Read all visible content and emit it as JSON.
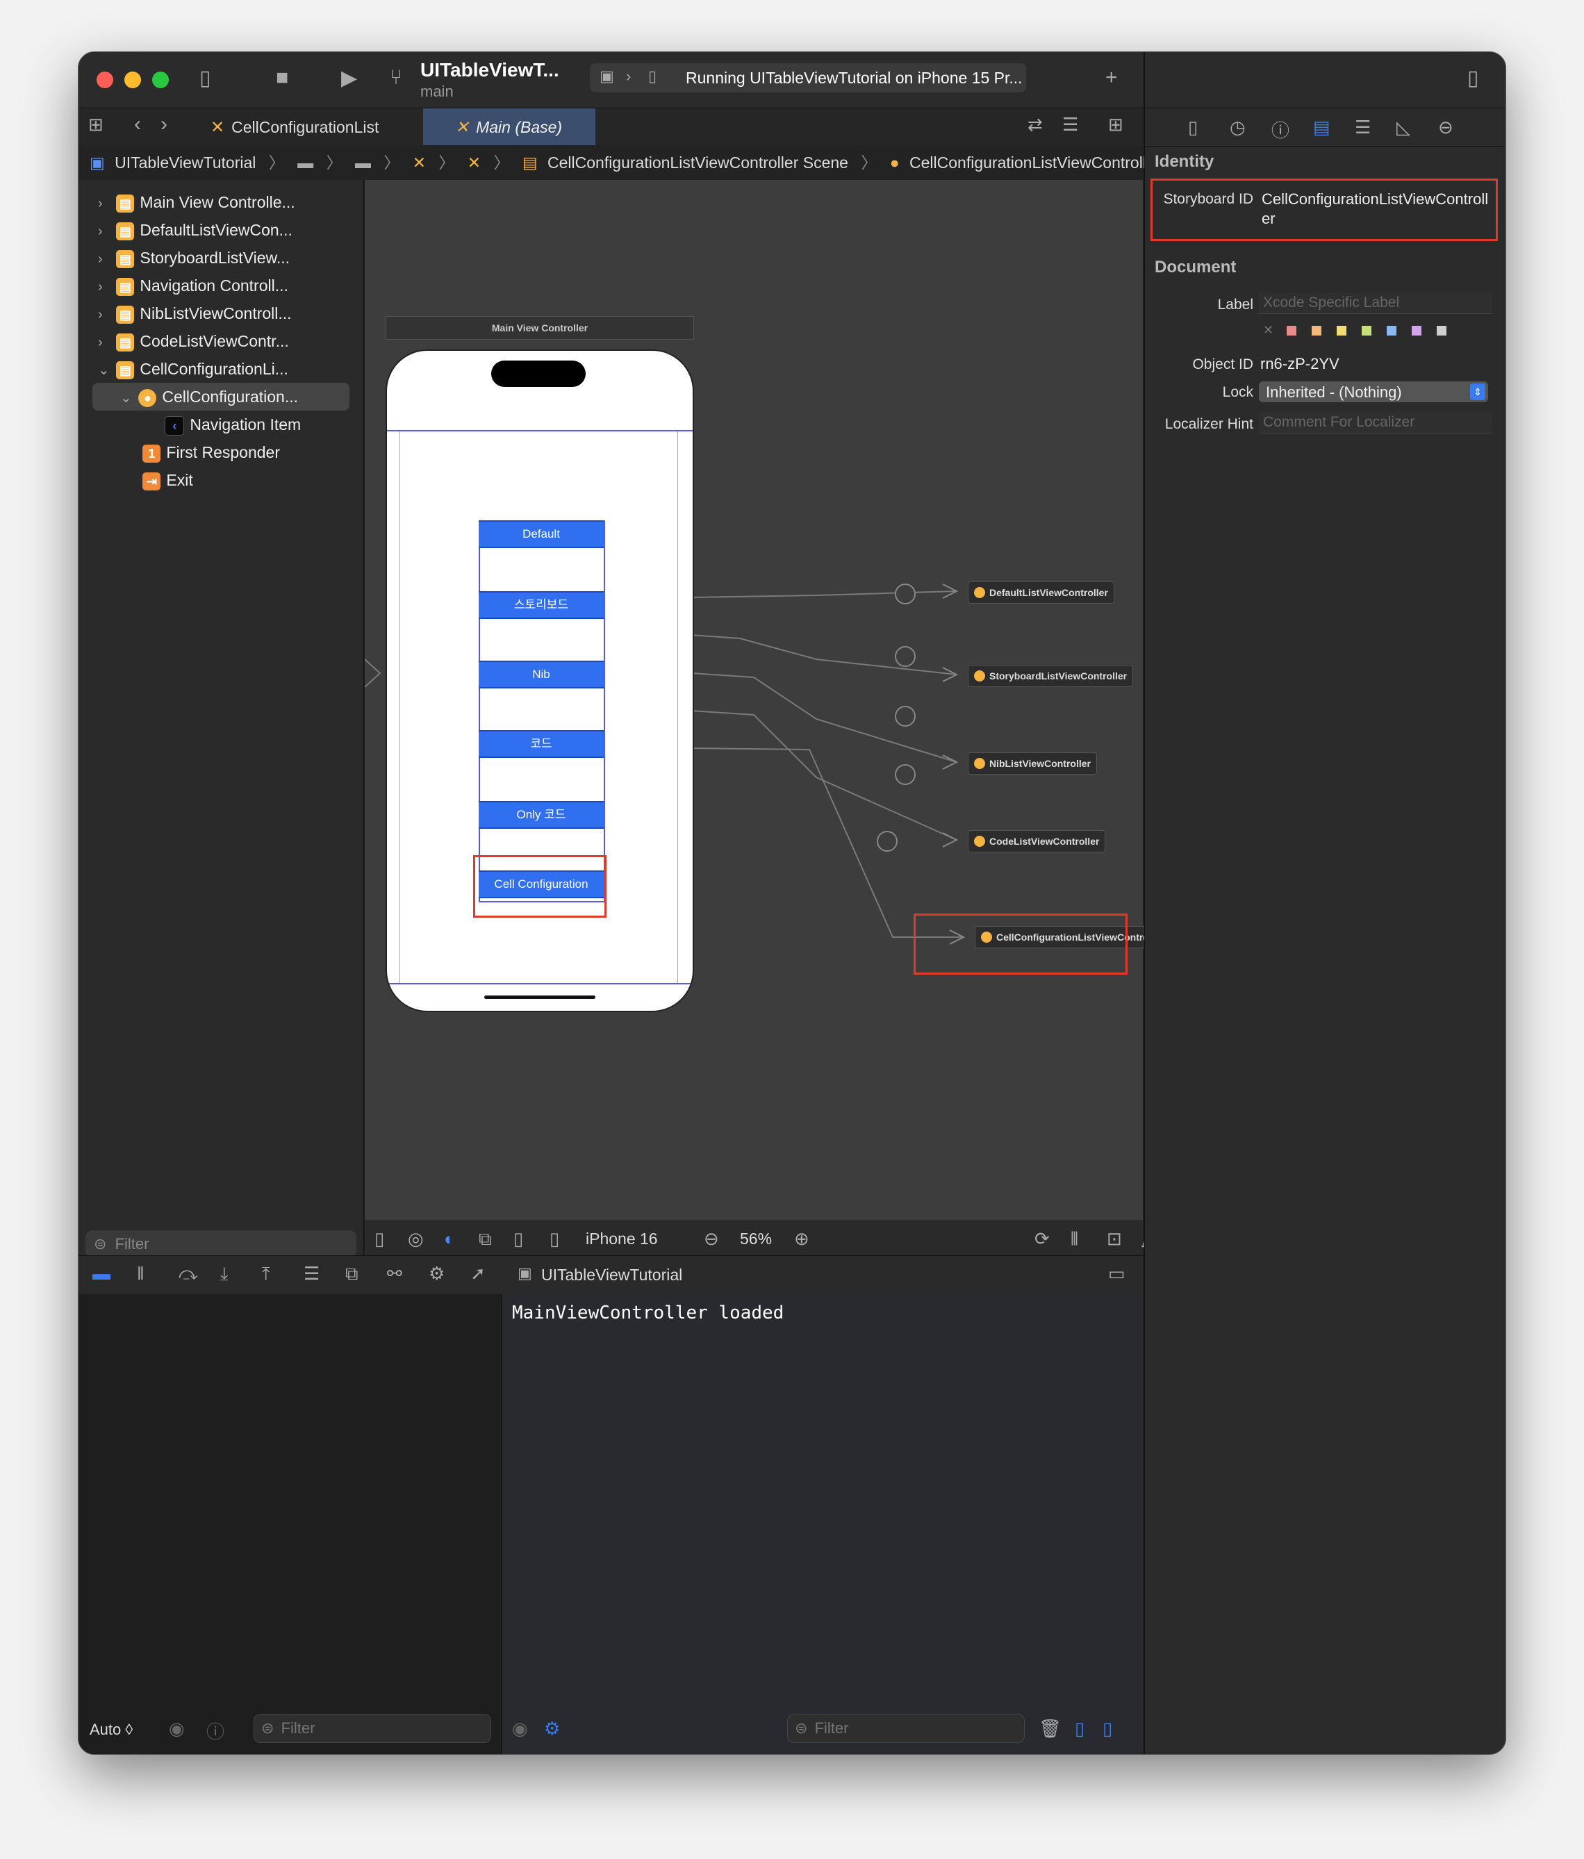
{
  "window": {
    "project_title": "UITableViewT...",
    "branch": "main",
    "run_status": "Running UITableViewTutorial on iPhone 15 Pr..."
  },
  "tabs": [
    {
      "label": "CellConfigurationList",
      "active": false
    },
    {
      "label": "Main (Base)",
      "active": true
    }
  ],
  "breadcrumb": {
    "project": "UITableViewTutorial",
    "scene": "CellConfigurationListViewController Scene",
    "controller": "CellConfigurationListViewController"
  },
  "navigator": {
    "items": [
      {
        "label": "Main View Controlle...",
        "level": 0,
        "expanded": false
      },
      {
        "label": "DefaultListViewCon...",
        "level": 0,
        "expanded": false
      },
      {
        "label": "StoryboardListView...",
        "level": 0,
        "expanded": false
      },
      {
        "label": "Navigation Controll...",
        "level": 0,
        "expanded": false
      },
      {
        "label": "NibListViewControll...",
        "level": 0,
        "expanded": false
      },
      {
        "label": "CodeListViewContr...",
        "level": 0,
        "expanded": false
      },
      {
        "label": "CellConfigurationLi...",
        "level": 0,
        "expanded": true
      },
      {
        "label": "CellConfiguration...",
        "level": 1,
        "expanded": true,
        "selected": true
      },
      {
        "label": "Navigation Item",
        "level": 2
      },
      {
        "label": "First Responder",
        "level": 1,
        "badge": "1"
      },
      {
        "label": "Exit",
        "level": 1
      }
    ],
    "filter_placeholder": "Filter"
  },
  "canvas": {
    "scene_title": "Main View Controller",
    "buttons": [
      "Default",
      "스토리보드",
      "Nib",
      "코드",
      "Only 코드",
      "Cell Configuration"
    ],
    "destinations": [
      "DefaultListViewController",
      "StoryboardListViewController",
      "NibListViewController",
      "CodeListViewController",
      "CellConfigurationListViewController"
    ],
    "device": "iPhone 16",
    "zoom": "56%"
  },
  "debug": {
    "target": "UITableViewTutorial",
    "console_output": "MainViewController loaded",
    "auto_label": "Auto ◊",
    "filter_placeholder": "Filter"
  },
  "inspector": {
    "identity_title": "Identity",
    "storyboard_id_label": "Storyboard ID",
    "storyboard_id_value": "CellConfigurationListViewController",
    "document_title": "Document",
    "label_label": "Label",
    "label_placeholder": "Xcode Specific Label",
    "object_id_label": "Object ID",
    "object_id_value": "rn6-zP-2YV",
    "lock_label": "Lock",
    "lock_value": "Inherited - (Nothing)",
    "localizer_label": "Localizer Hint",
    "localizer_placeholder": "Comment For Localizer",
    "swatches": [
      "#e88b8b",
      "#f2b97a",
      "#f0de72",
      "#c8e07a",
      "#8ab8f0",
      "#d4a4ec",
      "#cfcfcf"
    ]
  },
  "colors": {
    "accent": "#2f6ff0",
    "highlight": "#e03a2c",
    "class_icon": "#f5b342"
  }
}
